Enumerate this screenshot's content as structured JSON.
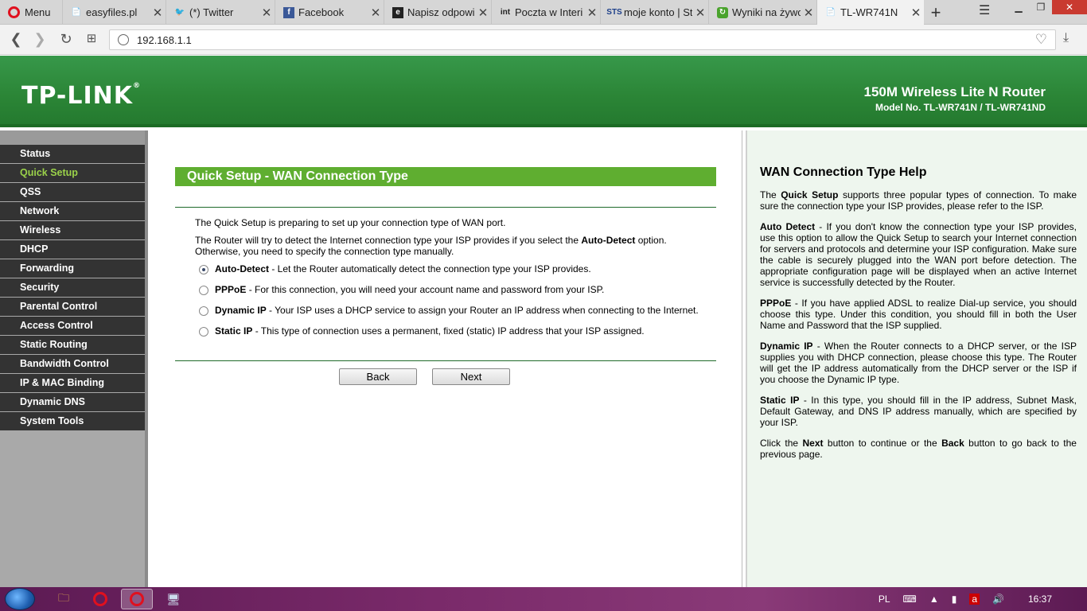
{
  "browser": {
    "menu_label": "Menu",
    "tabs": [
      {
        "title": "easyfiles.pl",
        "icon": "document-icon"
      },
      {
        "title": "(*) Twitter",
        "icon": "twitter-icon"
      },
      {
        "title": "Facebook",
        "icon": "facebook-icon"
      },
      {
        "title": "Napisz odpowie",
        "icon": "e-icon"
      },
      {
        "title": "Poczta w Interi",
        "icon": "int-icon"
      },
      {
        "title": "moje konto | St",
        "icon": "sts-icon"
      },
      {
        "title": "Wyniki na żywo",
        "icon": "refresh-icon"
      },
      {
        "title": "TL-WR741N",
        "icon": "document-icon"
      }
    ],
    "url": "192.168.1.1"
  },
  "header": {
    "logo": "TP-LINK",
    "logo_mark": "®",
    "product": "150M Wireless Lite N Router",
    "model": "Model No. TL-WR741N / TL-WR741ND"
  },
  "sidebar": {
    "items": [
      "Status",
      "Quick Setup",
      "QSS",
      "Network",
      "Wireless",
      "DHCP",
      "Forwarding",
      "Security",
      "Parental Control",
      "Access Control",
      "Static Routing",
      "Bandwidth Control",
      "IP & MAC Binding",
      "Dynamic DNS",
      "System Tools"
    ],
    "active_index": 1
  },
  "main": {
    "title": "Quick Setup - WAN Connection Type",
    "intro1": "The Quick Setup is preparing to set up your connection type of WAN port.",
    "intro2_a": "The Router will try to detect the Internet connection type your ISP provides if you select the ",
    "intro2_b": "Auto-Detect",
    "intro2_c": " option.",
    "intro3": "Otherwise, you need to specify the connection type manually.",
    "options": [
      {
        "name": "Auto-Detect",
        "desc": " - Let the Router automatically detect the connection type your ISP provides.",
        "checked": true
      },
      {
        "name": "PPPoE",
        "desc": " - For this connection, you will need your account name and password from your ISP.",
        "checked": false
      },
      {
        "name": "Dynamic IP",
        "desc": " - Your ISP uses a DHCP service to assign your Router an IP address when connecting to the Internet.",
        "checked": false
      },
      {
        "name": "Static IP",
        "desc": " - This type of connection uses a permanent, fixed (static) IP address that your ISP assigned.",
        "checked": false
      }
    ],
    "back_label": "Back",
    "next_label": "Next"
  },
  "help": {
    "title": "WAN Connection Type Help",
    "p1_a": "The ",
    "p1_b": "Quick Setup",
    "p1_c": " supports three popular types of connection. To make sure the connection type your ISP provides, please refer to the ISP.",
    "p2_a": "Auto Detect",
    "p2_b": " - If you don't know the connection type your ISP provides, use this option to allow the Quick Setup to search your Internet connection for servers and protocols and determine your ISP configuration. Make sure the cable is securely plugged into the WAN port before detection. The appropriate configuration page will be displayed when an active Internet service is successfully detected by the Router.",
    "p3_a": "PPPoE",
    "p3_b": " - If you have applied ADSL to realize Dial-up service, you should choose this type. Under this condition, you should fill in both the User Name and Password that the ISP supplied.",
    "p4_a": "Dynamic IP",
    "p4_b": " - When the Router connects to a DHCP server, or the ISP supplies you with DHCP connection, please choose this type. The Router will get the IP address automatically from the DHCP server or the ISP if you choose the Dynamic IP type.",
    "p5_a": "Static IP",
    "p5_b": " - In this type, you should fill in the IP address, Subnet Mask, Default Gateway, and DNS IP address manually, which are specified by your ISP.",
    "p6_a": "Click the ",
    "p6_b": "Next",
    "p6_c": " button to continue or the ",
    "p6_d": "Back",
    "p6_e": " button to go back to the previous page."
  },
  "taskbar": {
    "lang": "PL",
    "time": "16:37"
  },
  "colors": {
    "header_green": "#2e8a39",
    "title_green": "#5fae30",
    "active_menu": "#9bd24a",
    "menu_bg": "#333333",
    "help_bg": "#eef6ee"
  }
}
